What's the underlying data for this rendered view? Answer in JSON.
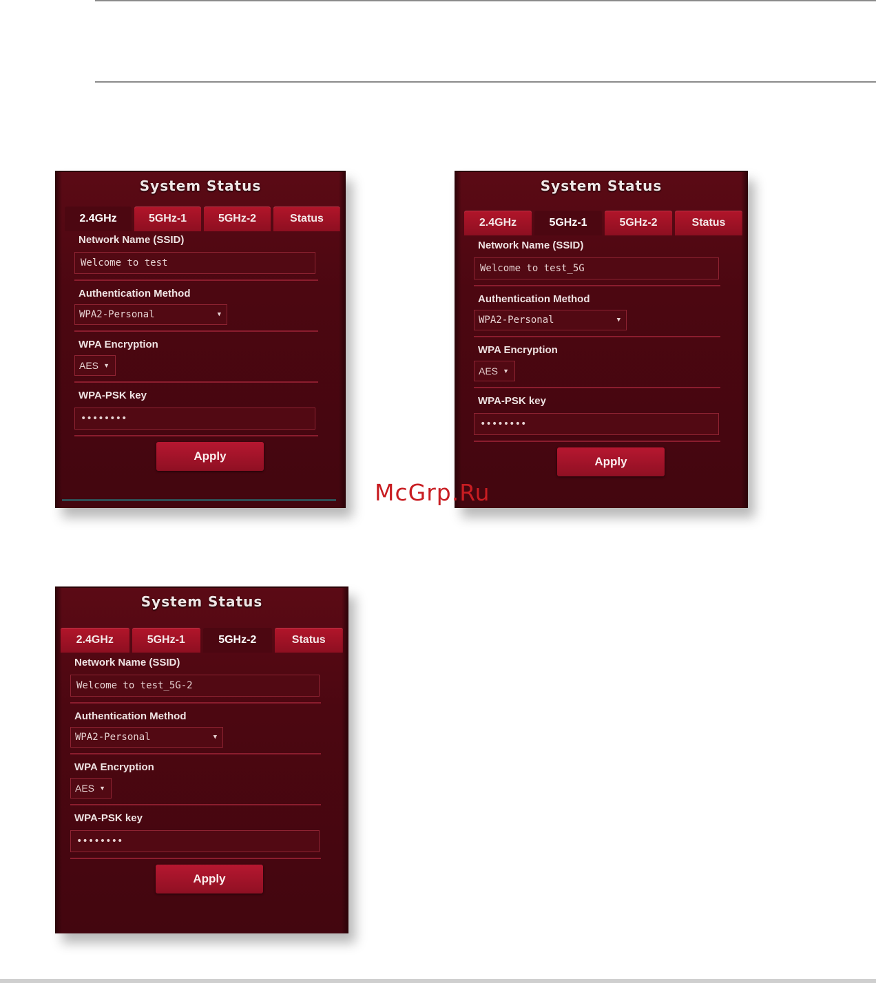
{
  "watermark": "McGrp.Ru",
  "panels": [
    {
      "title": "System Status",
      "tabs": [
        "2.4GHz",
        "5GHz-1",
        "5GHz-2",
        "Status"
      ],
      "active_tab": 0,
      "ssid_label": "Network Name (SSID)",
      "ssid_value": "Welcome to test",
      "auth_label": "Authentication Method",
      "auth_value": "WPA2-Personal",
      "enc_label": "WPA Encryption",
      "enc_value": "AES",
      "psk_label": "WPA-PSK key",
      "psk_value": "••••••••",
      "apply_label": "Apply"
    },
    {
      "title": "System Status",
      "tabs": [
        "2.4GHz",
        "5GHz-1",
        "5GHz-2",
        "Status"
      ],
      "active_tab": 1,
      "ssid_label": "Network Name (SSID)",
      "ssid_value": "Welcome to test_5G",
      "auth_label": "Authentication Method",
      "auth_value": "WPA2-Personal",
      "enc_label": "WPA Encryption",
      "enc_value": "AES",
      "psk_label": "WPA-PSK key",
      "psk_value": "••••••••",
      "apply_label": "Apply"
    },
    {
      "title": "System Status",
      "tabs": [
        "2.4GHz",
        "5GHz-1",
        "5GHz-2",
        "Status"
      ],
      "active_tab": 2,
      "ssid_label": "Network Name (SSID)",
      "ssid_value": "Welcome to test_5G-2",
      "auth_label": "Authentication Method",
      "auth_value": "WPA2-Personal",
      "enc_label": "WPA Encryption",
      "enc_value": "AES",
      "psk_label": "WPA-PSK key",
      "psk_value": "••••••••",
      "apply_label": "Apply"
    }
  ],
  "icons": {
    "dropdown": "caret-down-icon"
  },
  "colors": {
    "panel_bg": "#4c0711",
    "tab_bg": "#a01226",
    "button_bg": "#a8142b",
    "divider": "#8b1d2e",
    "watermark": "#c81d22"
  }
}
